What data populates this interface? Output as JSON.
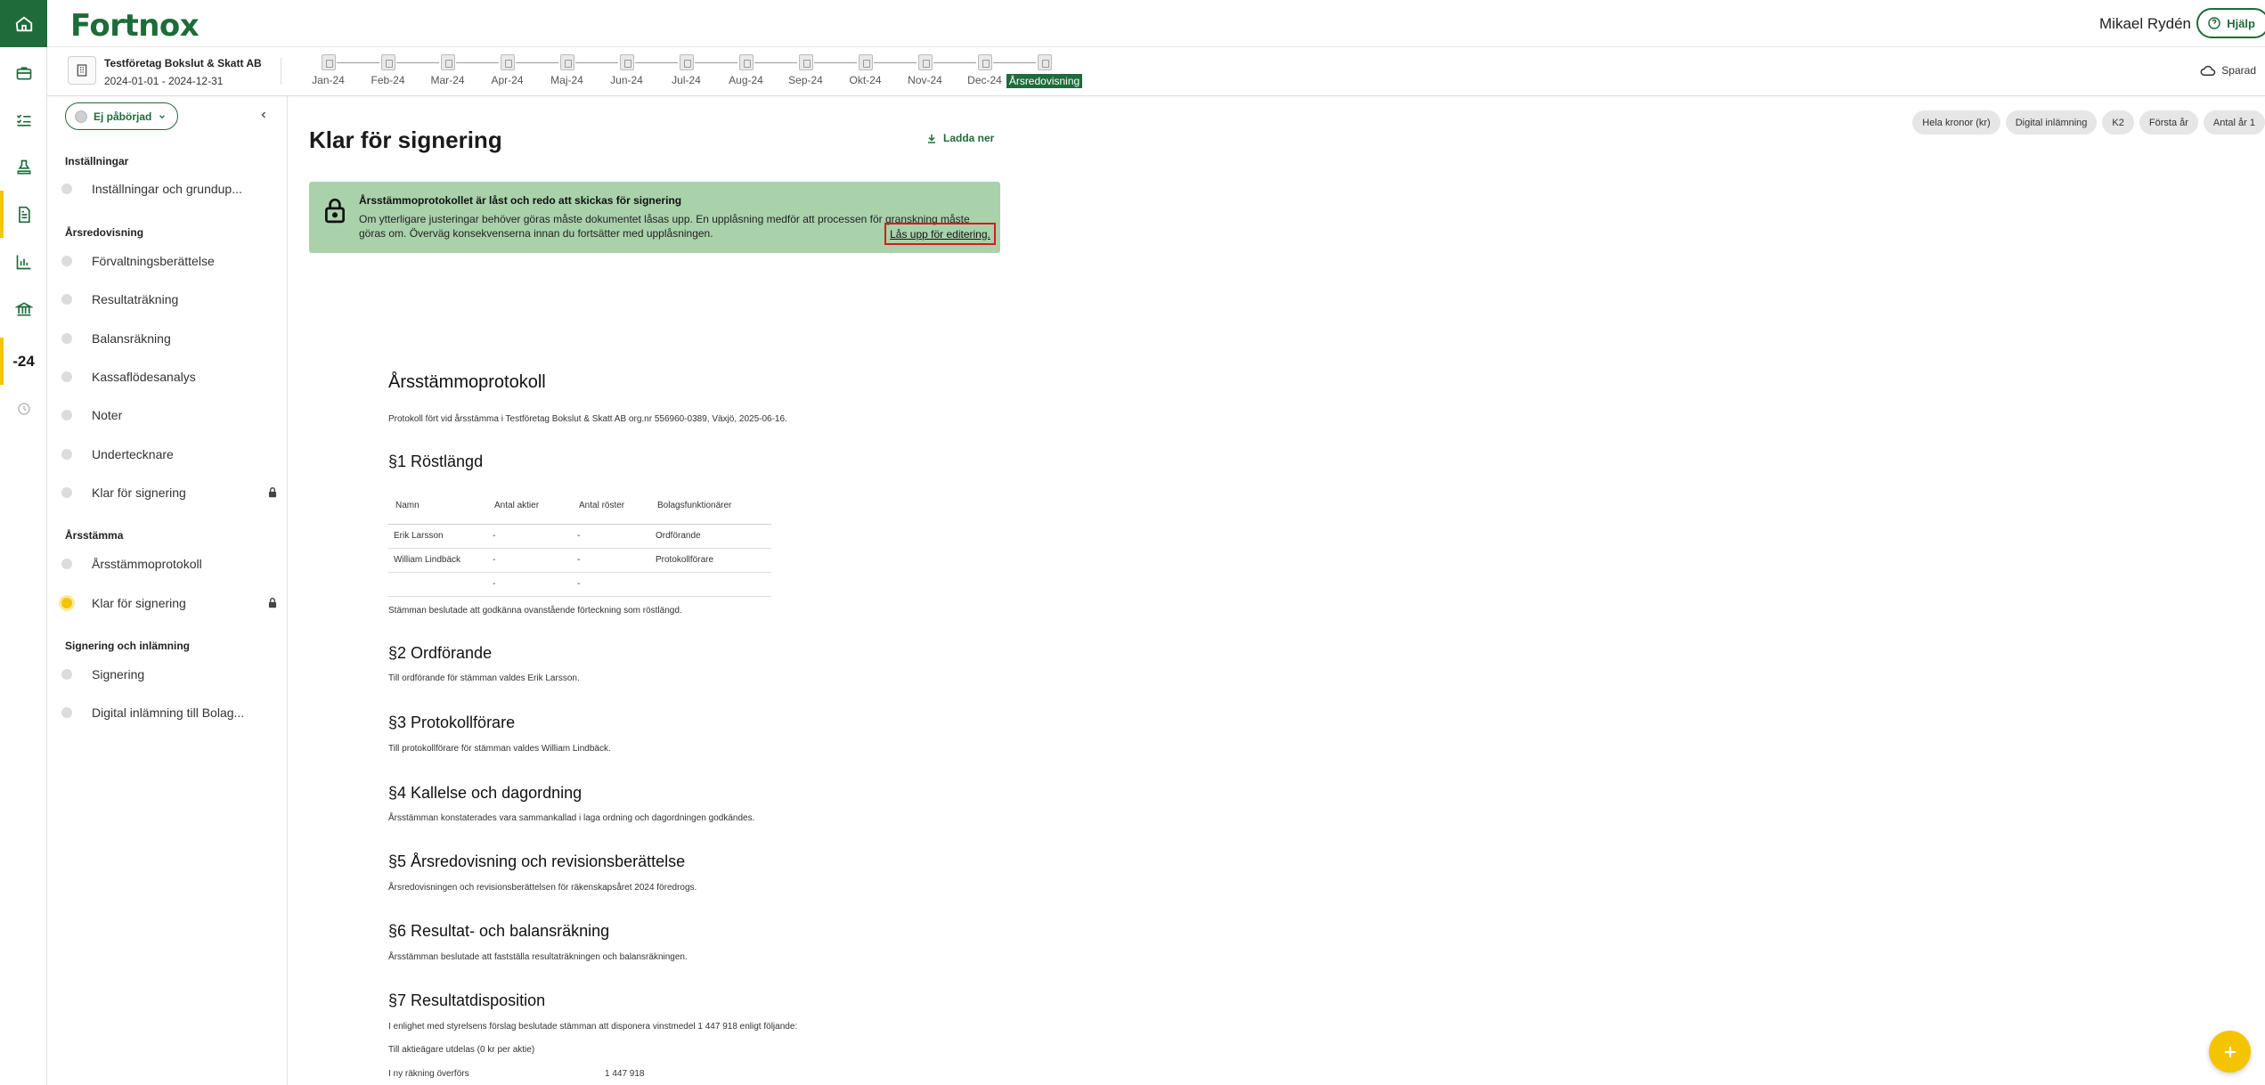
{
  "rail": {
    "year_label": "-24"
  },
  "header": {
    "logo": "Fortnox",
    "user_name": "Mikael Rydén",
    "help_label": "Hjälp"
  },
  "subheader": {
    "company_name": "Testföretag Bokslut & Skatt AB",
    "period": "2024-01-01 - 2024-12-31",
    "months": [
      "Jan-24",
      "Feb-24",
      "Mar-24",
      "Apr-24",
      "Maj-24",
      "Jun-24",
      "Jul-24",
      "Aug-24",
      "Sep-24",
      "Okt-24",
      "Nov-24",
      "Dec-24",
      "Årsredovisning"
    ],
    "saved_label": "Sparad"
  },
  "sidebar": {
    "status_label": "Ej påbörjad",
    "sections": [
      {
        "heading": "Inställningar",
        "items": [
          "Inställningar och grundup..."
        ]
      },
      {
        "heading": "Årsredovisning",
        "items": [
          "Förvaltningsberättelse",
          "Resultaträkning",
          "Balansräkning",
          "Kassaflödesanalys",
          "Noter",
          "Undertecknare",
          "Klar för signering"
        ]
      },
      {
        "heading": "Årsstämma",
        "items": [
          "Årsstämmoprotokoll",
          "Klar för signering"
        ]
      },
      {
        "heading": "Signering och inlämning",
        "items": [
          "Signering",
          "Digital inlämning till Bolag..."
        ]
      }
    ]
  },
  "main": {
    "title": "Klar för signering",
    "download_label": "Ladda ner",
    "chips": [
      "Hela kronor (kr)",
      "Digital inlämning",
      "K2",
      "Första år",
      "Antal år 1"
    ],
    "banner": {
      "title": "Årsstämmoprotokollet är låst och redo att skickas för signering",
      "text": "Om ytterligare justeringar behöver göras måste dokumentet låsas upp. En upplåsning medför att processen för granskning måste göras om. Överväg konsekvenserna innan du fortsätter med upplåsningen.",
      "link": "Lås upp för editering."
    }
  },
  "document": {
    "title": "Årsstämmoprotokoll",
    "intro": "Protokoll fört vid årsstämma i Testföretag Bokslut & Skatt AB org.nr 556960-0389, Växjö, 2025-06-16.",
    "s1_title": "§1 Röstlängd",
    "table_headers": [
      "Namn",
      "Antal aktier",
      "Antal röster",
      "Bolagsfunktionärer"
    ],
    "table_rows": [
      [
        "Erik Larsson",
        "-",
        "-",
        "Ordförande"
      ],
      [
        "William Lindbäck",
        "-",
        "-",
        "Protokollförare"
      ],
      [
        "",
        "-",
        "-",
        ""
      ]
    ],
    "s1_text": "Stämman beslutade att godkänna ovanstående förteckning som röstlängd.",
    "s2_title": "§2 Ordförande",
    "s2_text": "Till ordförande för stämman valdes Erik Larsson.",
    "s3_title": "§3 Protokollförare",
    "s3_text": "Till protokollförare för stämman valdes William Lindbäck.",
    "s4_title": "§4 Kallelse och dagordning",
    "s4_text": "Årsstämman konstaterades vara sammankallad i laga ordning och dagordningen godkändes.",
    "s5_title": "§5 Årsredovisning och revisionsberättelse",
    "s5_text": "Årsredovisningen och revisionsberättelsen för räkenskapsåret 2024 föredrogs.",
    "s6_title": "§6 Resultat- och balansräkning",
    "s6_text": "Årsstämman beslutade att fastställa resultaträkningen och balansräkningen.",
    "s7_title": "§7 Resultatdisposition",
    "s7_text": "I enlighet med styrelsens förslag beslutade stämman att disponera vinstmedel 1 447 918 enligt följande:",
    "s7_row1": "Till aktieägare utdelas (0 kr per aktie)",
    "s7_row2_label": "I ny räkning överförs",
    "s7_row2_value": "1 447 918"
  },
  "colors": {
    "brand": "#1f6b3a",
    "accent": "#f5c400",
    "banner": "#a9d2ab",
    "highlight": "#d81b1b"
  }
}
